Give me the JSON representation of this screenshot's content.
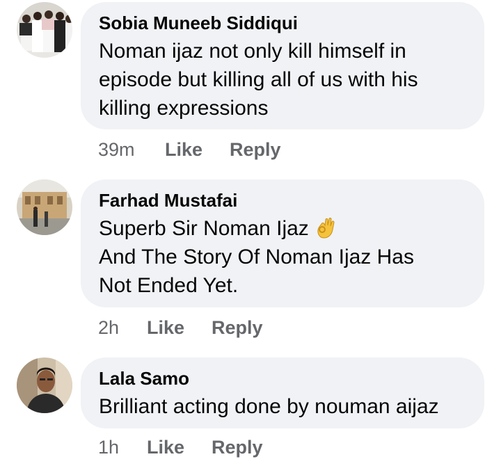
{
  "comments": [
    {
      "author": "Sobia Muneeb Siddiqui",
      "lines": [
        "Noman ijaz not only kill himself  in",
        "episode  but killing  all of us with his",
        "killing  expressions"
      ],
      "time": "39m",
      "like_label": "Like",
      "reply_label": "Reply",
      "avatar_icon": "group-photo-avatar"
    },
    {
      "author": "Farhad Mustafai",
      "lines": [
        "Superb Sir Noman Ijaz",
        "And The Story Of Noman Ijaz Has",
        "Not Ended Yet."
      ],
      "emoji_icon": "ok-hand-emoji",
      "time": "2h",
      "like_label": "Like",
      "reply_label": "Reply",
      "avatar_icon": "building-photo-avatar"
    },
    {
      "author": "Lala Samo",
      "lines": [
        "Brilliant acting done by nouman aijaz"
      ],
      "time": "1h",
      "like_label": "Like",
      "reply_label": "Reply",
      "avatar_icon": "person-photo-avatar"
    }
  ],
  "colors": {
    "bubble": "#f0f2f5",
    "text": "#050505",
    "meta": "#65676b"
  }
}
